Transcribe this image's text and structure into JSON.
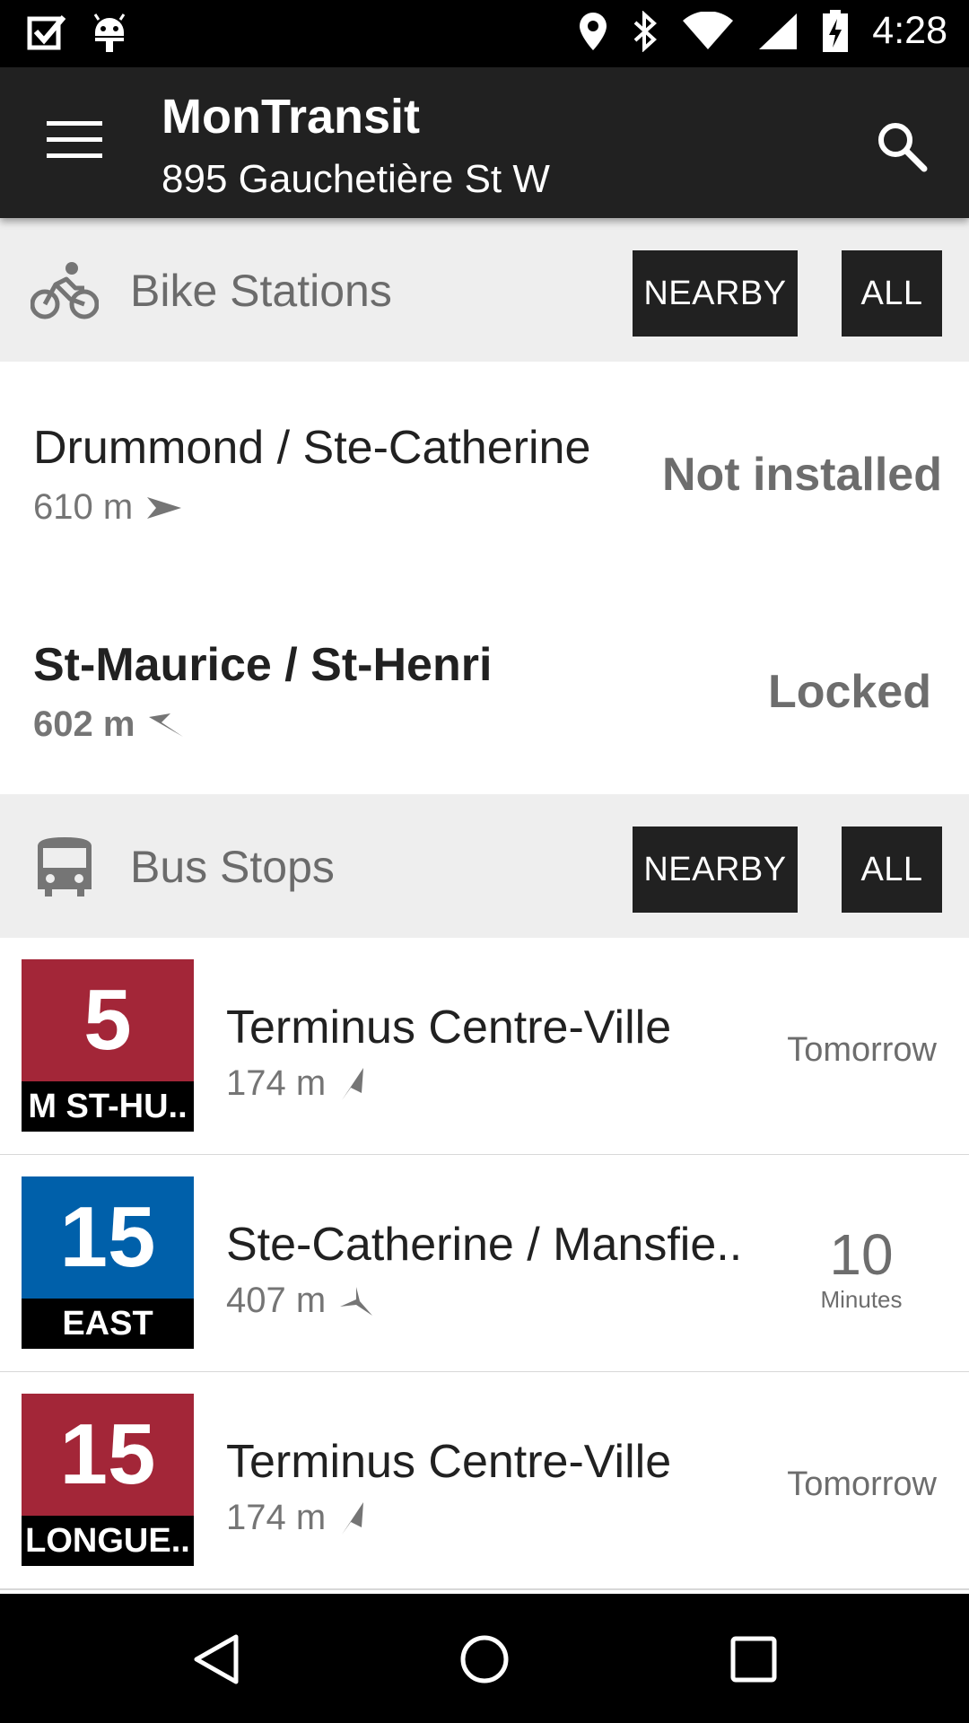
{
  "status_bar": {
    "time": "4:28",
    "icons": [
      "checkbox-icon",
      "android-icon",
      "location-icon",
      "bluetooth-icon",
      "wifi-icon",
      "signal-icon",
      "battery-charging-icon"
    ]
  },
  "app_bar": {
    "title": "MonTransit",
    "subtitle": "895 Gauchetière St W",
    "menu_icon": "hamburger-menu-icon",
    "search_icon": "search-icon"
  },
  "bike_section": {
    "title": "Bike Stations",
    "icon": "bike-icon",
    "nearby_label": "NEARBY",
    "all_label": "ALL",
    "items": [
      {
        "name": "Drummond / Ste-Catherine",
        "distance": "610 m",
        "status": "Not installed"
      },
      {
        "name": "St-Maurice / St-Henri",
        "distance": "602 m",
        "status": "Locked"
      }
    ]
  },
  "bus_section": {
    "title": "Bus Stops",
    "icon": "bus-icon",
    "nearby_label": "NEARBY",
    "all_label": "ALL",
    "items": [
      {
        "route": "5",
        "direction": "M ST-HU..",
        "color": "#A32638",
        "stop": "Terminus Centre-Ville",
        "distance": "174 m",
        "time": "Tomorrow"
      },
      {
        "route": "15",
        "direction": "EAST",
        "color": "#0060AA",
        "stop": "Ste-Catherine / Mansfie..",
        "distance": "407 m",
        "time_value": "10",
        "time_unit": "Minutes"
      },
      {
        "route": "15",
        "direction": "LONGUE..",
        "color": "#A32638",
        "stop": "Terminus Centre-Ville",
        "distance": "174 m",
        "time": "Tomorrow"
      }
    ]
  },
  "nav_bar": {
    "icons": [
      "back-icon",
      "home-icon",
      "recents-icon"
    ]
  },
  "colors": {
    "app_bar": "#212121",
    "section_bg": "#EEEEEE",
    "route_red": "#A32638",
    "route_blue": "#0060AA"
  }
}
